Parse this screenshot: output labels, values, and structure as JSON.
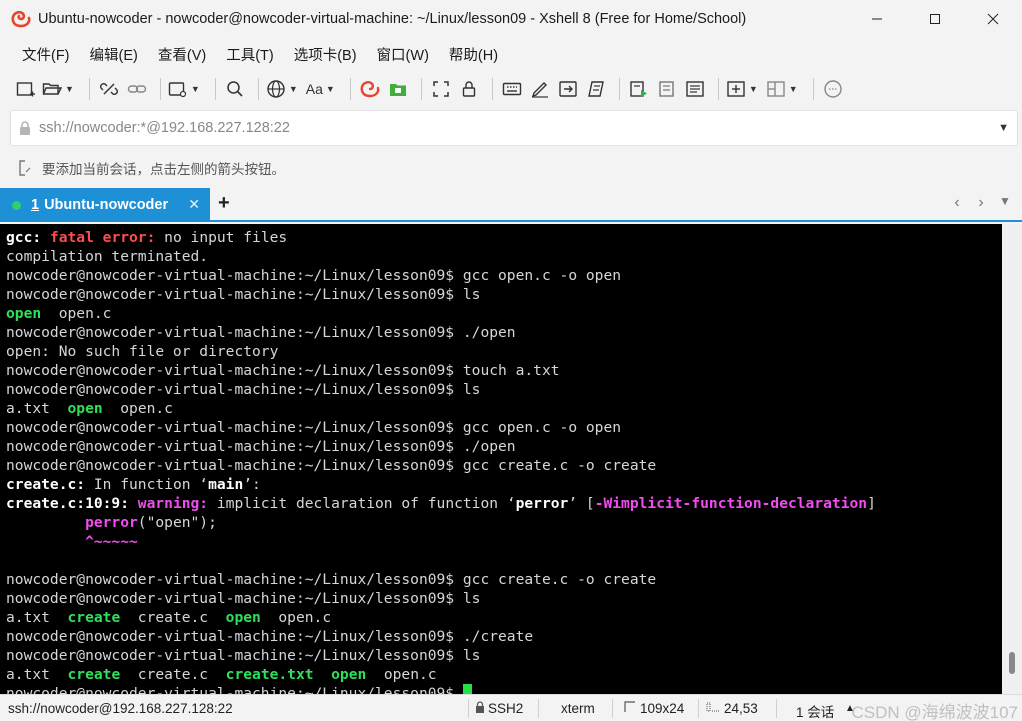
{
  "window": {
    "title": "Ubuntu-nowcoder - nowcoder@nowcoder-virtual-machine: ~/Linux/lesson09 - Xshell 8 (Free for Home/School)",
    "app_icon": "xshell-logo-icon",
    "controls": [
      "minimize-icon",
      "maximize-icon",
      "close-icon"
    ]
  },
  "menu": {
    "items": [
      "文件(F)",
      "编辑(E)",
      "查看(V)",
      "工具(T)",
      "选项卡(B)",
      "窗口(W)",
      "帮助(H)"
    ]
  },
  "toolbar": {
    "font_label": "Aa"
  },
  "address": {
    "value": "ssh://nowcoder:*@192.168.227.128:22"
  },
  "hint": {
    "text": "要添加当前会话，点击左侧的箭头按钮。"
  },
  "tabs": {
    "active": {
      "number": "1",
      "name": "Ubuntu-nowcoder",
      "status_color": "#2bd16a"
    },
    "accent_color": "#1e90d6"
  },
  "terminal": {
    "lines": [
      [
        {
          "t": "gcc: ",
          "c": "bold"
        },
        {
          "t": "fatal error: ",
          "c": "red"
        },
        {
          "t": "no input files"
        }
      ],
      [
        {
          "t": "compilation terminated."
        }
      ],
      [
        {
          "t": "nowcoder@nowcoder-virtual-machine:~/Linux/lesson09$ gcc open.c -o open"
        }
      ],
      [
        {
          "t": "nowcoder@nowcoder-virtual-machine:~/Linux/lesson09$ ls"
        }
      ],
      [
        {
          "t": "open",
          "c": "green"
        },
        {
          "t": "  open.c"
        }
      ],
      [
        {
          "t": "nowcoder@nowcoder-virtual-machine:~/Linux/lesson09$ ./open"
        }
      ],
      [
        {
          "t": "open: No such file or directory"
        }
      ],
      [
        {
          "t": "nowcoder@nowcoder-virtual-machine:~/Linux/lesson09$ touch a.txt"
        }
      ],
      [
        {
          "t": "nowcoder@nowcoder-virtual-machine:~/Linux/lesson09$ ls"
        }
      ],
      [
        {
          "t": "a.txt  "
        },
        {
          "t": "open",
          "c": "green"
        },
        {
          "t": "  open.c"
        }
      ],
      [
        {
          "t": "nowcoder@nowcoder-virtual-machine:~/Linux/lesson09$ gcc open.c -o open"
        }
      ],
      [
        {
          "t": "nowcoder@nowcoder-virtual-machine:~/Linux/lesson09$ ./open"
        }
      ],
      [
        {
          "t": "nowcoder@nowcoder-virtual-machine:~/Linux/lesson09$ gcc create.c -o create"
        }
      ],
      [
        {
          "t": "create.c:",
          "c": "bold"
        },
        {
          "t": " In function ‘"
        },
        {
          "t": "main",
          "c": "bold"
        },
        {
          "t": "’:"
        }
      ],
      [
        {
          "t": "create.c:10:9: ",
          "c": "bold"
        },
        {
          "t": "warning: ",
          "c": "mag"
        },
        {
          "t": "implicit declaration of function ‘"
        },
        {
          "t": "perror",
          "c": "bold"
        },
        {
          "t": "’ ["
        },
        {
          "t": "-Wimplicit-function-declaration",
          "c": "mag"
        },
        {
          "t": "]"
        }
      ],
      [
        {
          "t": "         "
        },
        {
          "t": "perror",
          "c": "mag"
        },
        {
          "t": "(\"open\");"
        }
      ],
      [
        {
          "t": "         "
        },
        {
          "t": "^~~~~~",
          "c": "mag"
        }
      ],
      [
        {
          "t": ""
        }
      ],
      [
        {
          "t": "nowcoder@nowcoder-virtual-machine:~/Linux/lesson09$ gcc create.c -o create"
        }
      ],
      [
        {
          "t": "nowcoder@nowcoder-virtual-machine:~/Linux/lesson09$ ls"
        }
      ],
      [
        {
          "t": "a.txt  "
        },
        {
          "t": "create",
          "c": "green"
        },
        {
          "t": "  create.c  "
        },
        {
          "t": "open",
          "c": "green"
        },
        {
          "t": "  open.c"
        }
      ],
      [
        {
          "t": "nowcoder@nowcoder-virtual-machine:~/Linux/lesson09$ ./create"
        }
      ],
      [
        {
          "t": "nowcoder@nowcoder-virtual-machine:~/Linux/lesson09$ ls"
        }
      ],
      [
        {
          "t": "a.txt  "
        },
        {
          "t": "create",
          "c": "green"
        },
        {
          "t": "  create.c  "
        },
        {
          "t": "create.txt",
          "c": "green"
        },
        {
          "t": "  "
        },
        {
          "t": "open",
          "c": "green"
        },
        {
          "t": "  open.c"
        }
      ],
      [
        {
          "t": "nowcoder@nowcoder-virtual-machine:~/Linux/lesson09$ "
        },
        {
          "cursor": true
        }
      ]
    ]
  },
  "status": {
    "connection": "ssh://nowcoder@192.168.227.128:22",
    "protocol": "SSH2",
    "terminal_type": "xterm",
    "size": "109x24",
    "cursor_pos": "24,53",
    "sessions": "1 会话",
    "watermark": "CSDN @海绵波波107"
  }
}
